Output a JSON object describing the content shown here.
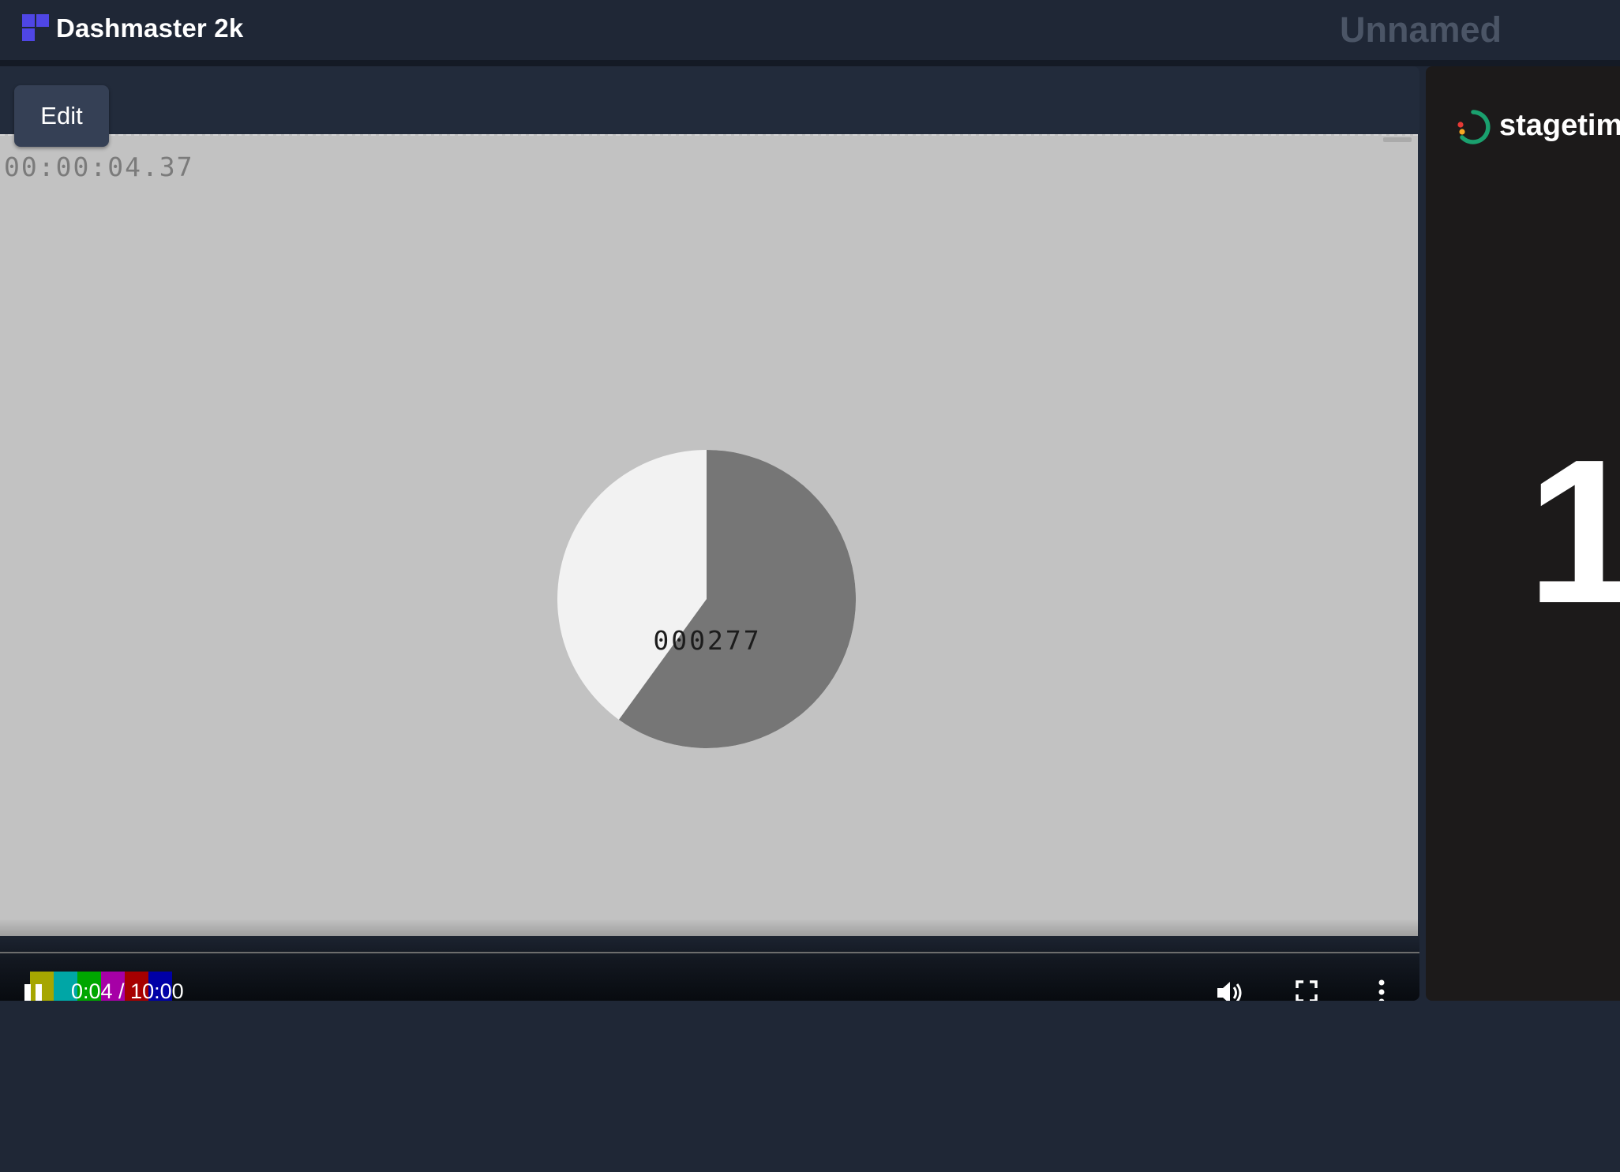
{
  "app": {
    "title": "Dashmaster 2k",
    "dashboard_name": "Unnamed",
    "colors": {
      "background": "#1f2736",
      "logo": "#4f46e5",
      "button": "#354055",
      "dashboard_name": "#4b5566"
    }
  },
  "video_panel": {
    "edit_label": "Edit",
    "overlay_timecode": "00:00:04.37",
    "overlay_counter": "000277",
    "overlay_pie_filled_fraction": 0.6,
    "time_display": "0:04 / 10:00",
    "progress": {
      "played_fraction": 0.013,
      "buffered_fraction": 0.09
    },
    "controls": {
      "play_pause_icon": "pause-icon",
      "volume_icon": "volume-icon",
      "fullscreen_icon": "fullscreen-icon",
      "more_icon": "more-vertical-icon"
    },
    "color_bars": [
      "#a6a600",
      "#00a6a6",
      "#00a600",
      "#a600a6",
      "#a60000",
      "#0000a6"
    ]
  },
  "stagetimer_panel": {
    "brand": "stagetim",
    "display_digit": "1",
    "colors": {
      "ring": "#1aa06e",
      "dot_red": "#e53935",
      "dot_orange": "#f6a623"
    }
  }
}
